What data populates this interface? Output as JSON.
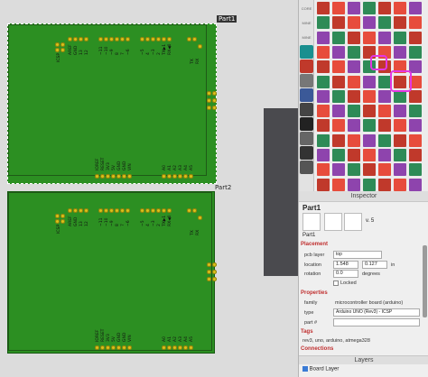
{
  "canvas": {
    "part_label_top": "Part1",
    "part_label_bottom": "Part2",
    "header_silk": [
      "AREF",
      "GND",
      "13",
      "12",
      "~11",
      "~10",
      "~9",
      "8",
      "7",
      "~6",
      "~5",
      "4",
      "~3",
      "2",
      "TX▶1",
      "RX◀0"
    ],
    "power_silk": [
      "IOREF",
      "RESET",
      "3V3",
      "5V",
      "GND",
      "GND",
      "VIN"
    ],
    "analog_silk": [
      "A0",
      "A1",
      "A2",
      "A3",
      "A4",
      "A5"
    ],
    "icsp": "ICSP",
    "tx": "TX",
    "rx": "RX"
  },
  "bin": {
    "tabs": [
      "CORE",
      "MINE",
      "MINE"
    ],
    "colors": [
      "#c0392b",
      "#1f8fbf",
      "#2e8b57",
      "#d35400",
      "#8e44ad",
      "#16a085",
      "#e74c3c",
      "#2c3e50"
    ]
  },
  "inspector": {
    "title": "Inspector",
    "part_name": "Part1",
    "version": "v. 5",
    "part_sub": "Part1",
    "placement_header": "Placement",
    "pcb_layer_label": "pcb layer",
    "pcb_layer_value": "top",
    "location_label": "location",
    "location_x": "1.548",
    "location_y": "0.127",
    "location_unit": "in",
    "rotation_label": "rotation",
    "rotation_value": "0.0",
    "rotation_unit": "degrees",
    "locked_label": "Locked",
    "properties_header": "Properties",
    "family_label": "family",
    "family_value": "microcontroller board (arduino)",
    "type_label": "type",
    "type_value": "Arduino UNO (Rev3) - ICSP",
    "partnum_label": "part #",
    "partnum_value": "",
    "tags_header": "Tags",
    "tags_value": "rev3, uno, arduino, atmega328",
    "connections_header": "Connections",
    "layers_title": "Layers",
    "board_layer": "Board Layer"
  }
}
